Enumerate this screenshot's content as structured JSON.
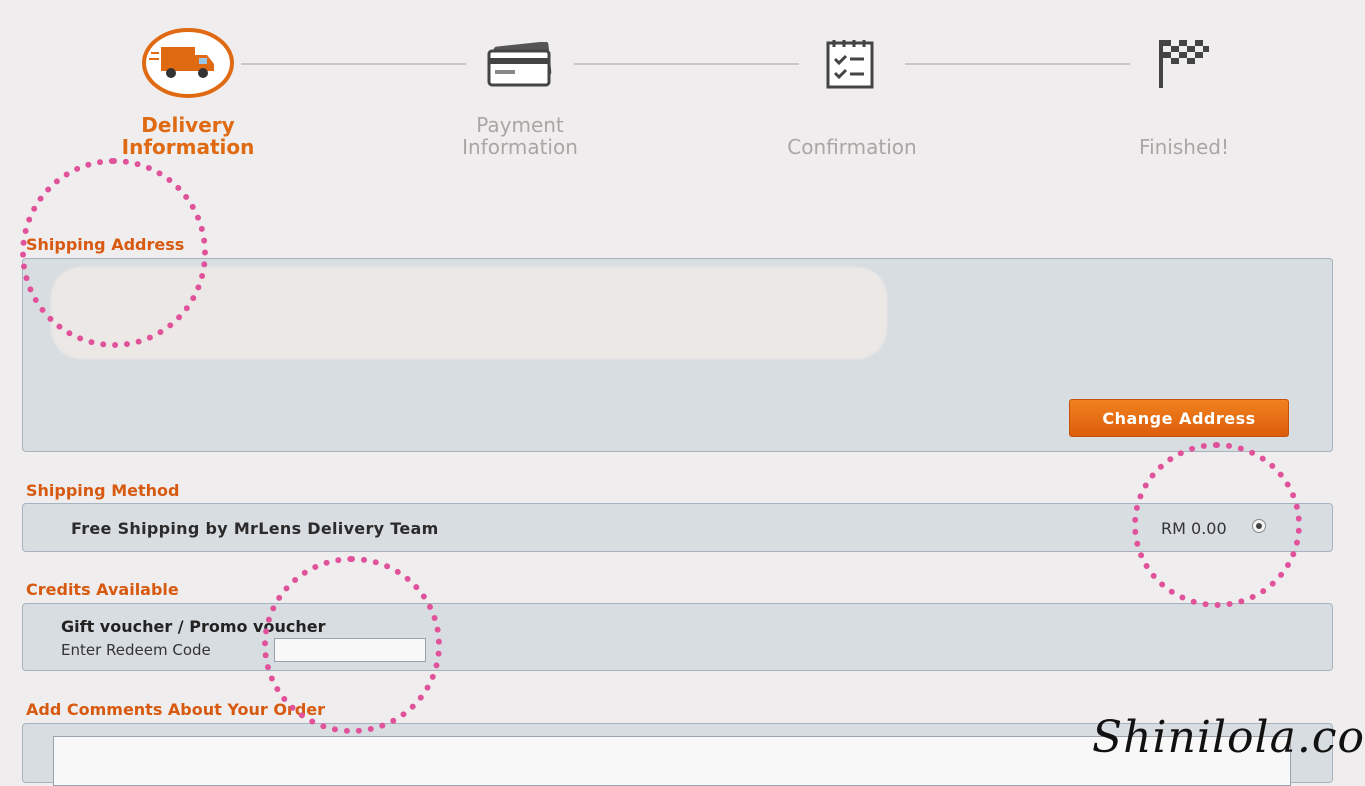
{
  "steps": [
    {
      "line1": "Delivery",
      "line2": "Information",
      "icon": "truck-icon",
      "active": true
    },
    {
      "line1": "Payment",
      "line2": "Information",
      "icon": "credit-card-icon",
      "active": false
    },
    {
      "line1": "",
      "line2": "Confirmation",
      "icon": "checklist-icon",
      "active": false
    },
    {
      "line1": "",
      "line2": "Finished!",
      "icon": "checkered-flag-icon",
      "active": false
    }
  ],
  "shipping_address": {
    "title": "Shipping Address",
    "change_button": "Change Address"
  },
  "shipping_method": {
    "title": "Shipping Method",
    "option_label": "Free Shipping by MrLens Delivery Team",
    "price": "RM 0.00"
  },
  "credits": {
    "title": "Credits Available",
    "voucher_label": "Gift voucher / Promo voucher",
    "redeem_label": "Enter Redeem Code",
    "redeem_value": ""
  },
  "comments": {
    "title": "Add Comments About Your Order"
  },
  "watermark": "Shinilola.com",
  "colors": {
    "accent": "#e06a12",
    "annotation": "#e0529a",
    "panel": "#d8dde2"
  }
}
